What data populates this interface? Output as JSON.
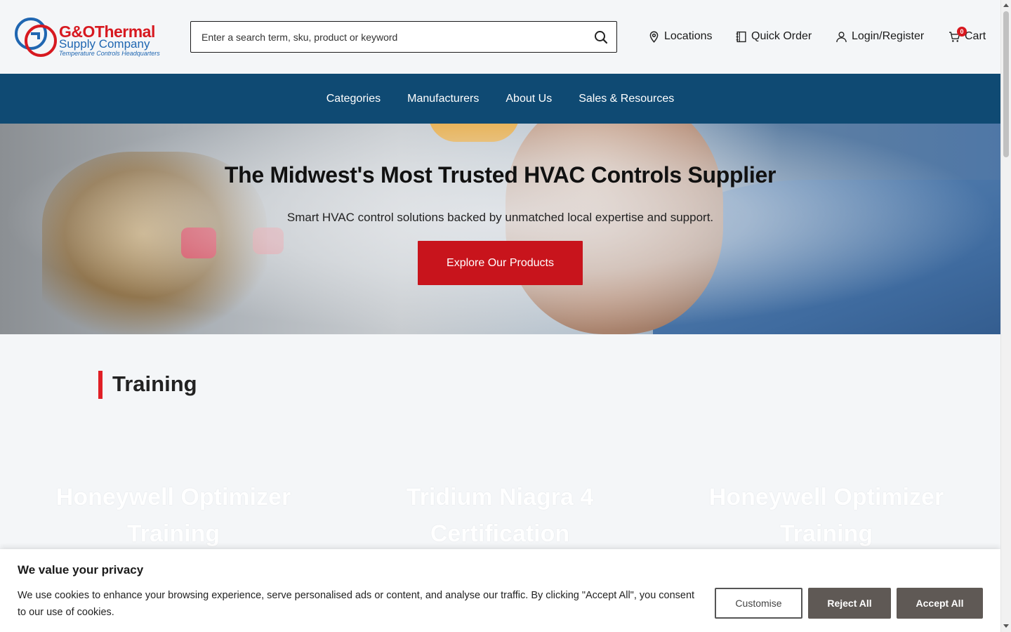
{
  "header": {
    "logo": {
      "line1": "G&OThermal",
      "line2": "Supply Company",
      "tagline": "Temperature Controls Headquarters"
    },
    "search": {
      "placeholder": "Enter a search term, sku, product or keyword",
      "icon": "search-icon"
    },
    "utility": {
      "locations": "Locations",
      "quick_order": "Quick Order",
      "login": "Login/Register",
      "cart": "Cart",
      "cart_count": "0"
    }
  },
  "nav": {
    "items": [
      "Categories",
      "Manufacturers",
      "About Us",
      "Sales & Resources"
    ]
  },
  "hero": {
    "title": "The Midwest's Most Trusted HVAC Controls Supplier",
    "subtitle": "Smart HVAC control solutions backed by unmatched local expertise and support.",
    "cta": "Explore Our Products"
  },
  "training": {
    "title": "Training",
    "cards": [
      "Honeywell Optimizer Training",
      "Tridium Niagra 4 Certification",
      "Honeywell Optimizer Training"
    ]
  },
  "cookie": {
    "title": "We value your privacy",
    "text": "We use cookies to enhance your browsing experience, serve personalised ads or content, and analyse our traffic. By clicking \"Accept All\", you consent to our use of cookies.",
    "customise": "Customise",
    "reject": "Reject All",
    "accept": "Accept All"
  },
  "colors": {
    "nav_bg": "#0f4a73",
    "brand_red": "#c8141c",
    "brand_blue": "#1f66b1",
    "cookie_button": "#5f5955"
  }
}
